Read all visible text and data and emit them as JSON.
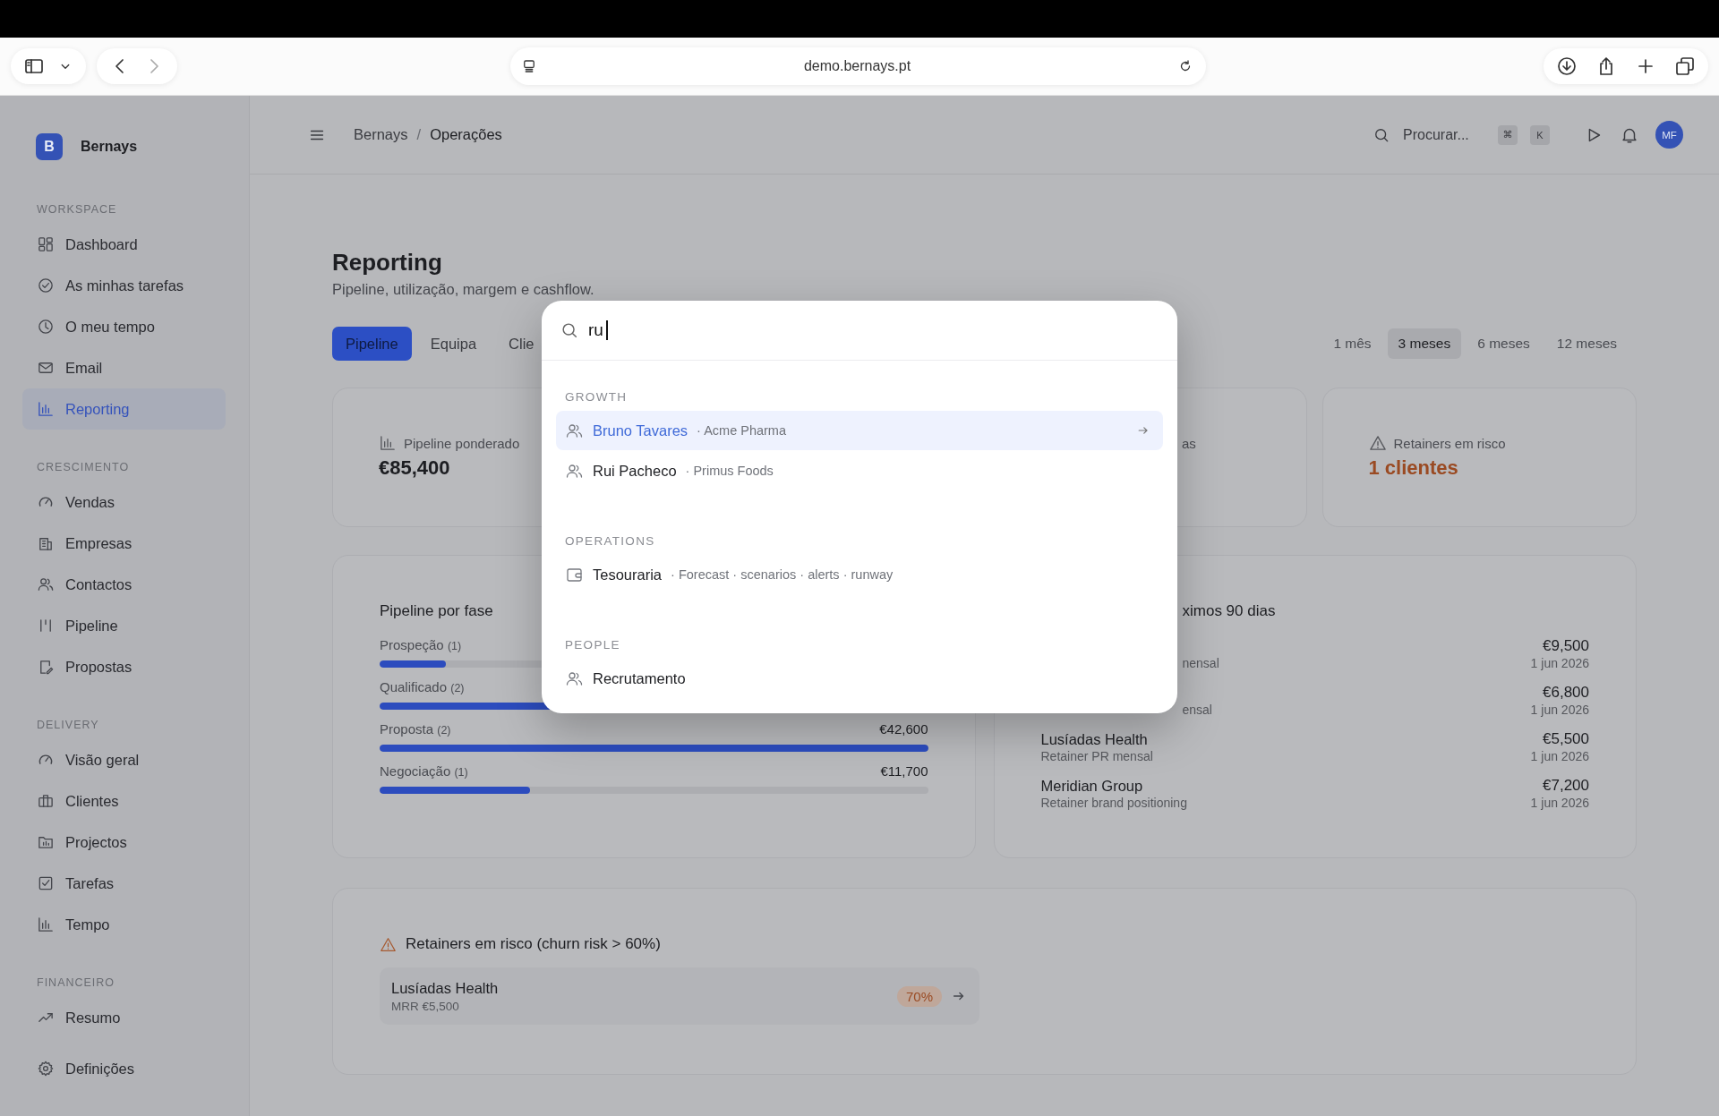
{
  "browser": {
    "url": "demo.bernays.pt"
  },
  "sidebar": {
    "brand": {
      "initial": "B",
      "name": "Bernays"
    },
    "sections": [
      {
        "title": "WORKSPACE",
        "items": [
          {
            "label": "Dashboard",
            "selected": false
          },
          {
            "label": "As minhas tarefas",
            "selected": false
          },
          {
            "label": "O meu tempo",
            "selected": false
          },
          {
            "label": "Email",
            "selected": false
          },
          {
            "label": "Reporting",
            "selected": true
          }
        ]
      },
      {
        "title": "CRESCIMENTO",
        "items": [
          {
            "label": "Vendas",
            "selected": false
          },
          {
            "label": "Empresas",
            "selected": false
          },
          {
            "label": "Contactos",
            "selected": false
          },
          {
            "label": "Pipeline",
            "selected": false
          },
          {
            "label": "Propostas",
            "selected": false
          }
        ]
      },
      {
        "title": "DELIVERY",
        "items": [
          {
            "label": "Visão geral",
            "selected": false
          },
          {
            "label": "Clientes",
            "selected": false
          },
          {
            "label": "Projectos",
            "selected": false
          },
          {
            "label": "Tarefas",
            "selected": false
          },
          {
            "label": "Tempo",
            "selected": false
          }
        ]
      },
      {
        "title": "FINANCEIRO",
        "items": [
          {
            "label": "Resumo",
            "selected": false
          }
        ]
      }
    ],
    "footer_item": {
      "label": "Definições",
      "selected": false
    }
  },
  "header": {
    "breadcrumb": [
      "Bernays",
      "Operações"
    ],
    "breadcrumb_separator": "/",
    "search": {
      "placeholder": "Procurar..."
    },
    "shortcut_keys": [
      "⌘",
      "K"
    ],
    "avatar": "MF"
  },
  "page": {
    "title": "Reporting",
    "subtitle": "Pipeline, utilização, margem e cashflow.",
    "tabs": [
      {
        "label": "Pipeline",
        "selected": true
      },
      {
        "label": "Equipa",
        "selected": false
      },
      {
        "label": "Clie",
        "selected": false
      }
    ],
    "periods": [
      {
        "label": "1 mês",
        "selected": false
      },
      {
        "label": "3 meses",
        "selected": true
      },
      {
        "label": "6 meses",
        "selected": false
      },
      {
        "label": "12 meses",
        "selected": false
      }
    ],
    "kpis": [
      {
        "kind": "metric",
        "label": "Pipeline ponderado",
        "value": "€85,400"
      },
      {
        "kind": "peek",
        "label": "as"
      },
      {
        "kind": "alert",
        "label": "Retainers em risco",
        "value": "1 clientes"
      }
    ],
    "pipeline_by_stage": {
      "title": "Pipeline por fase",
      "stages": [
        {
          "label": "Prospeção",
          "count": "(1)",
          "level": 0.12
        },
        {
          "label": "Qualificado",
          "count": "(2)",
          "level": 0.5
        },
        {
          "label": "Proposta",
          "count": "(2)",
          "amount": "€42,600",
          "level": 1
        },
        {
          "label": "Negociação",
          "count": "(1)",
          "amount": "€11,700",
          "level": 0.275
        }
      ]
    },
    "renewals": {
      "title": "ximos 90 dias",
      "items": [
        {
          "detail": "nensal",
          "amount": "€9,500",
          "date": "1 jun 2026"
        },
        {
          "detail": "ensal",
          "amount": "€6,800",
          "date": "1 jun 2026"
        },
        {
          "name": "Lusíadas Health",
          "detail": "Retainer PR mensal",
          "amount": "€5,500",
          "date": "1 jun 2026"
        },
        {
          "name": "Meridian Group",
          "detail": "Retainer brand positioning",
          "amount": "€7,200",
          "date": "1 jun 2026"
        }
      ]
    },
    "risk": {
      "title": "Retainers em risco (churn risk > 60%)",
      "items": [
        {
          "name": "Lusíadas Health",
          "detail": "MRR €5,500",
          "risk": "70%"
        }
      ]
    }
  },
  "command_palette": {
    "query": "ru",
    "groups": [
      {
        "title": "GROWTH",
        "items": [
          {
            "label": "Bruno Tavares",
            "detail": "· Acme Pharma",
            "selected": true
          },
          {
            "label": "Rui Pacheco",
            "detail": "· Primus Foods",
            "selected": false
          }
        ]
      },
      {
        "title": "OPERATIONS",
        "items": [
          {
            "label": "Tesouraria",
            "detail": "· Forecast · scenarios · alerts · runway",
            "selected": false
          }
        ]
      },
      {
        "title": "PEOPLE",
        "items": [
          {
            "label": "Recrutamento",
            "selected": false
          }
        ]
      }
    ]
  }
}
